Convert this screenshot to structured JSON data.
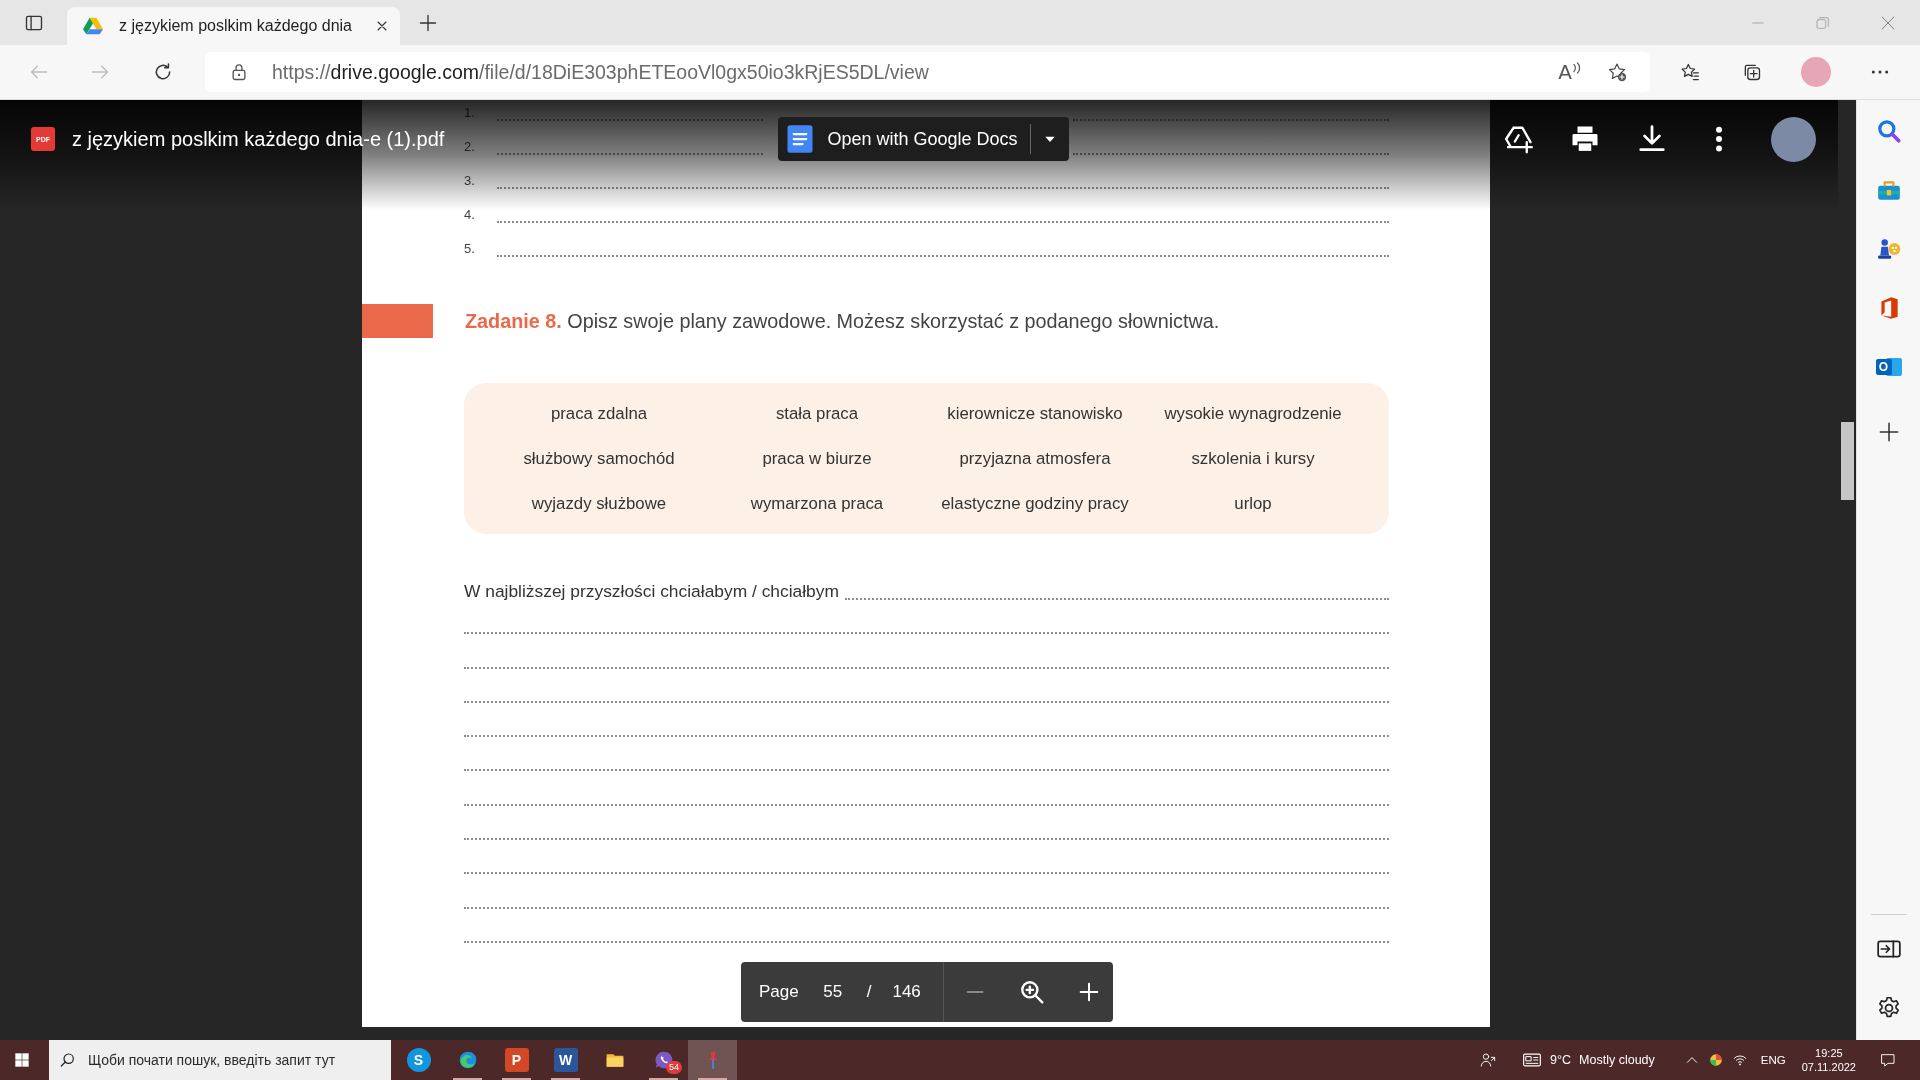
{
  "browser": {
    "tabs": [
      {
        "title": "z językiem poslkim każdego dnia",
        "selected": true
      }
    ],
    "address": {
      "scheme": "https://",
      "host": "drive.google.com",
      "path": "/file/d/18DiE303phETEooVl0gx50io3kRjES5DL/view",
      "read_aloud": "A"
    }
  },
  "viewer": {
    "file_type": "PDF",
    "file_name": "z językiem poslkim każdego dnia-e (1).pdf",
    "open_with": "Open with Google Docs"
  },
  "document": {
    "answer_numbers": [
      "1.",
      "2.",
      "3.",
      "4.",
      "5."
    ],
    "task": "**Zadanie 8.** Opisz swoje plany zawodowe. Możesz skorzystać z podanego słownictwa.",
    "vocabulary": [
      "praca zdalna",
      "stała praca",
      "kierownicze stanowisko",
      "wysokie wynagrodzenie",
      "służbowy samochód",
      "praca w biurze",
      "przyjazna atmosfera",
      "szkolenia i kursy",
      "wyjazdy służbowe",
      "wymarzona praca",
      "elastyczne godziny pracy",
      "urlop"
    ],
    "writing_prompt": "W najbliższej przyszłości chciałabym / chciałbym"
  },
  "page_controls": {
    "label": "Page",
    "current": "55",
    "separator": "/",
    "total": "146"
  },
  "edge_sidebar": [
    {
      "kind": "search"
    },
    {
      "kind": "tools"
    },
    {
      "kind": "games"
    },
    {
      "kind": "office"
    },
    {
      "kind": "outlook",
      "glyph": "O"
    },
    {
      "kind": "add"
    }
  ],
  "taskbar": {
    "search_placeholder": "Щоби почати пошук, введіть запит тут",
    "apps": [
      {
        "kind": "skype",
        "glyph": "S",
        "running": false,
        "selected": false
      },
      {
        "kind": "edge",
        "running": true,
        "selected": false
      },
      {
        "kind": "powerpoint",
        "glyph": "P",
        "running": true,
        "selected": false
      },
      {
        "kind": "word",
        "glyph": "W",
        "running": true,
        "selected": false
      },
      {
        "kind": "explorer",
        "running": false,
        "selected": false
      },
      {
        "kind": "viber",
        "badge": "54",
        "running": true,
        "selected": false
      },
      {
        "kind": "pin",
        "running": true,
        "selected": true
      }
    ],
    "temperature": "9°C",
    "weather": "Mostly cloudy",
    "language": "ENG",
    "time": "19:25",
    "date": "07.11.2022"
  }
}
